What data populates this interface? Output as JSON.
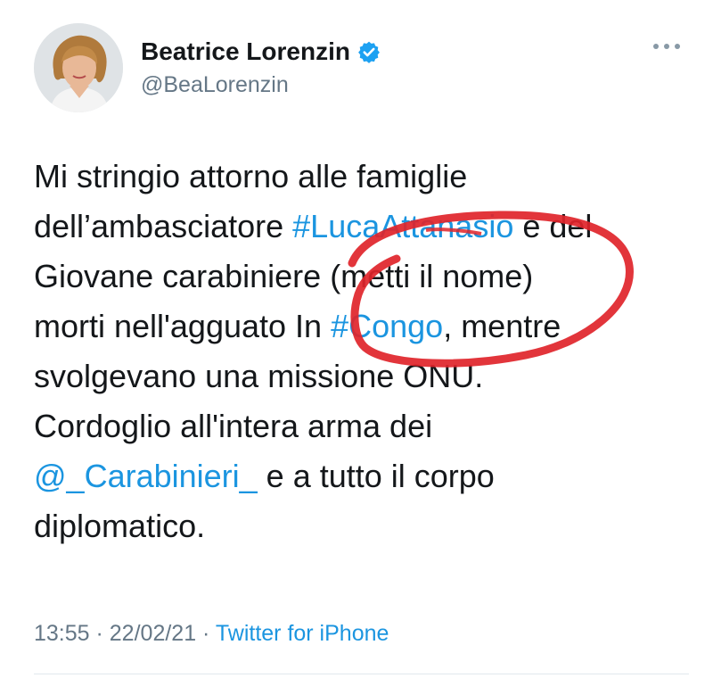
{
  "user": {
    "display_name": "Beatrice Lorenzin",
    "handle": "@BeaLorenzin",
    "verified": true
  },
  "tweet": {
    "lines": [
      [
        {
          "text": "Mi stringio attorno alle famiglie"
        }
      ],
      [
        {
          "text": "dell’ambasciatore "
        },
        {
          "text": "#LucaAttanasio",
          "link": true
        },
        {
          "text": " e del"
        }
      ],
      [
        {
          "text": "Giovane carabiniere (metti il nome)"
        }
      ],
      [
        {
          "text": "morti nell'agguato In "
        },
        {
          "text": "#Congo",
          "link": true
        },
        {
          "text": ", mentre"
        }
      ],
      [
        {
          "text": "svolgevano una missione ONU."
        }
      ],
      [
        {
          "text": "Cordoglio all'intera arma dei"
        }
      ],
      [
        {
          "text": "@_Carabinieri_",
          "link": true
        },
        {
          "text": " e a tutto il corpo"
        }
      ],
      [
        {
          "text": "diplomatico."
        }
      ]
    ]
  },
  "meta": {
    "time": "13:55",
    "separator_1": " · ",
    "date": "22/02/21",
    "separator_2": " · ",
    "source": "Twitter for iPhone"
  },
  "colors": {
    "link": "#1b95e0",
    "annotation": "#e0242a",
    "text": "#14171a",
    "muted": "#657786"
  },
  "icons": {
    "verified": "verified-badge-icon",
    "more": "more-options-icon"
  }
}
